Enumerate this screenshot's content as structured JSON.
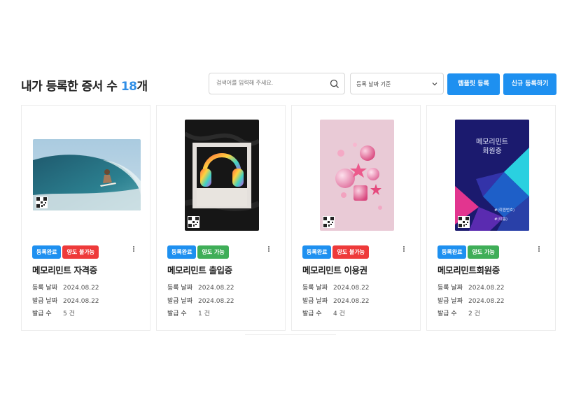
{
  "header": {
    "title_prefix": "내가 등록한 증서 수",
    "count": "18",
    "count_suffix": "개",
    "search_placeholder": "검색어를 입력해 주세요.",
    "sort_selected": "등록 날짜 기준",
    "template_button": "템플릿 등록",
    "new_button": "신규 등록하기"
  },
  "labels": {
    "registered_date": "등록 날짜",
    "issued_date": "발급 날짜",
    "issued_count": "발급 수"
  },
  "cards": [
    {
      "status": "등록완료",
      "transfer": "양도 불가능",
      "transfer_color": "#ee3a3a",
      "name": "메모리민트 자격증",
      "registered": "2024.08.22",
      "issued": "2024.08.22",
      "count": "5 건",
      "image": "surfer-wave"
    },
    {
      "status": "등록완료",
      "transfer": "양도 가능",
      "transfer_color": "#3fae58",
      "name": "메모리민트 출입증",
      "registered": "2024.08.22",
      "issued": "2024.08.22",
      "count": "1 건",
      "image": "glass-headphones"
    },
    {
      "status": "등록완료",
      "transfer": "양도 불가능",
      "transfer_color": "#ee3a3a",
      "name": "메모리민트 이용권",
      "registered": "2024.08.22",
      "issued": "2024.08.22",
      "count": "4 건",
      "image": "pink-3d-shapes"
    },
    {
      "status": "등록완료",
      "transfer": "양도 가능",
      "transfer_color": "#3fae58",
      "name": "메모리민트회원증",
      "registered": "2024.08.22",
      "issued": "2024.08.22",
      "count": "2 건",
      "image": "membership-card",
      "card_title": "메모리민트\n회원증",
      "card_line1": "#(회원번호)",
      "card_line2": "#(이름)"
    }
  ],
  "colors": {
    "accent": "#1e90f0",
    "count": "#2f8ee6"
  }
}
